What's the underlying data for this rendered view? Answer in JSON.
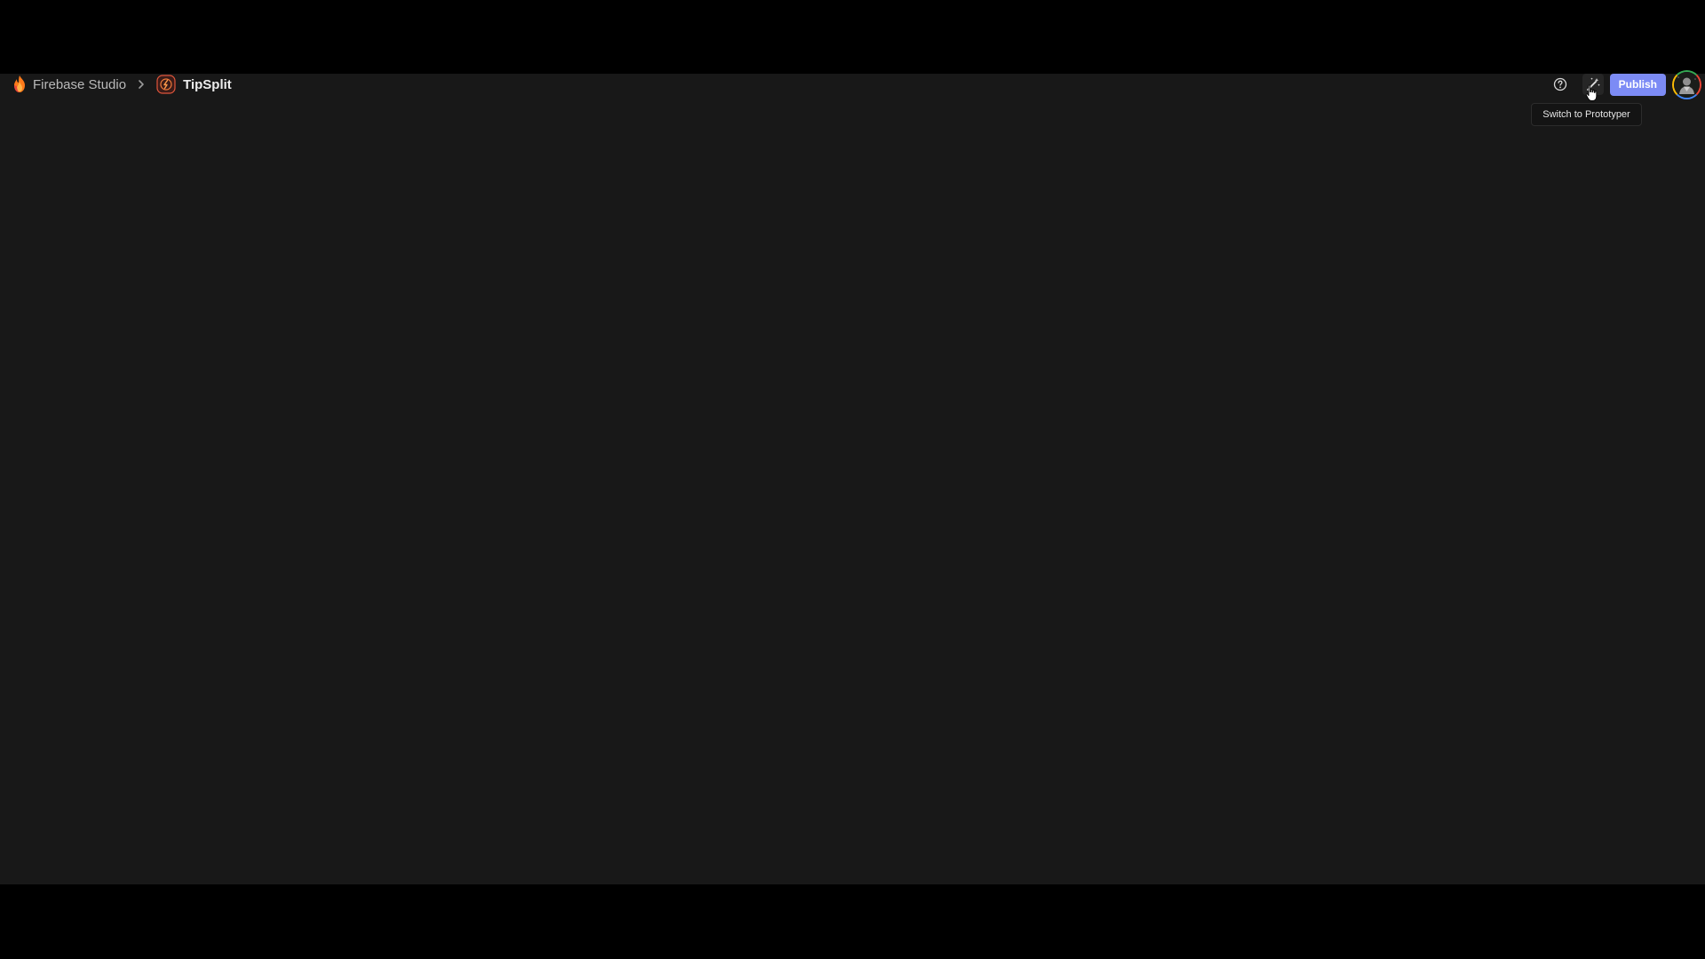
{
  "breadcrumb": {
    "product": "Firebase Studio",
    "separator_icon": "chevron-right-icon",
    "project": "TipSplit"
  },
  "toolbar": {
    "help_icon": "help-circle-icon",
    "switch_icon": "magic-wand-icon",
    "publish_label": "Publish",
    "avatar_icon": "avatar"
  },
  "tooltip": {
    "text": "Switch to Prototyper"
  },
  "colors": {
    "background": "#181818",
    "letterbox": "#000000",
    "accent": "#7c8bf5",
    "firebase_orange": "#ff7a1a"
  }
}
